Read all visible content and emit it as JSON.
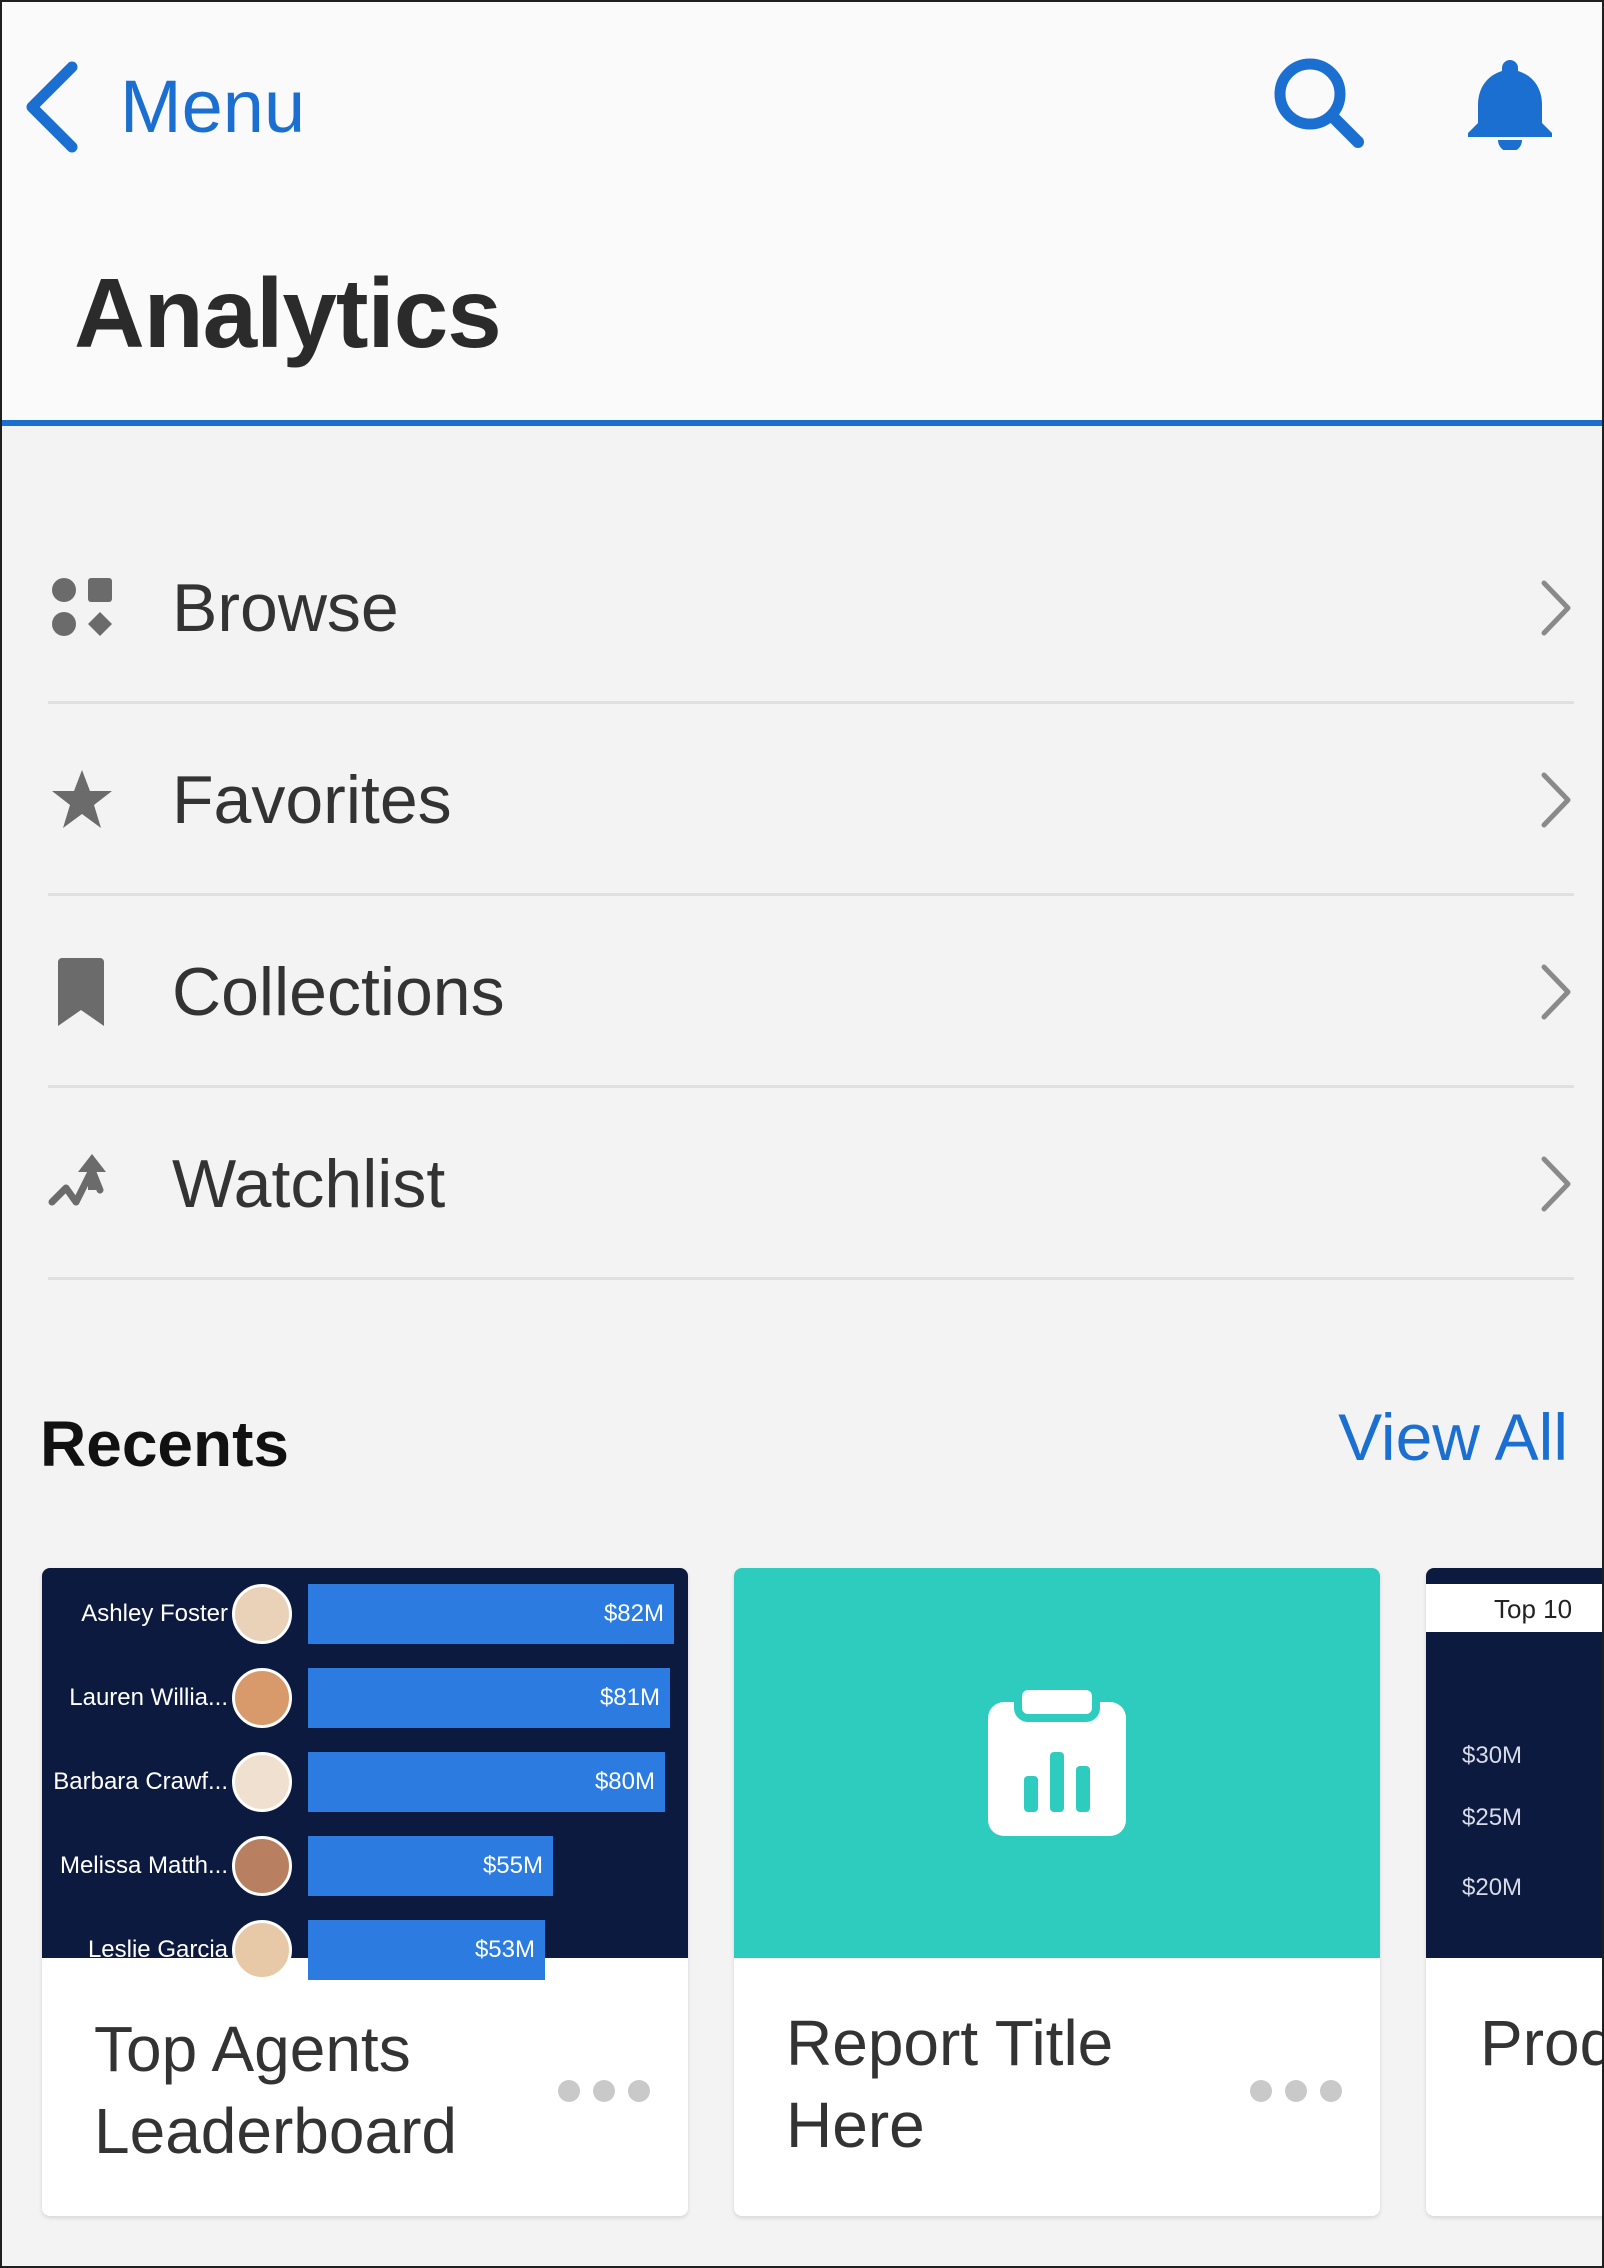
{
  "header": {
    "back_label": "Menu",
    "title": "Analytics"
  },
  "nav": [
    {
      "label": "Browse",
      "icon": "browse-icon"
    },
    {
      "label": "Favorites",
      "icon": "star-icon"
    },
    {
      "label": "Collections",
      "icon": "bookmark-icon"
    },
    {
      "label": "Watchlist",
      "icon": "watchlist-icon"
    }
  ],
  "recents": {
    "title": "Recents",
    "view_all": "View All",
    "cards": [
      {
        "title": "Top Agents Leaderboard",
        "leaderboard": [
          {
            "name": "Ashley Foster",
            "value": "$82M",
            "amount": 82
          },
          {
            "name": "Lauren Willia...",
            "value": "$81M",
            "amount": 81
          },
          {
            "name": "Barbara Crawf...",
            "value": "$80M",
            "amount": 80
          },
          {
            "name": "Melissa Matth...",
            "value": "$55M",
            "amount": 55
          },
          {
            "name": "Leslie Garcia",
            "value": "$53M",
            "amount": 53
          }
        ]
      },
      {
        "title": "Report Title Here",
        "thumb_color": "#2ecbbf"
      },
      {
        "title": "Prod Anal",
        "chart_label": "Top 10",
        "ticks": [
          "$30M",
          "$25M",
          "$20M"
        ]
      }
    ]
  },
  "colors": {
    "accent": "#1b6fd1",
    "thumb_dark": "#0d1a3f",
    "bar": "#2b7be0"
  }
}
